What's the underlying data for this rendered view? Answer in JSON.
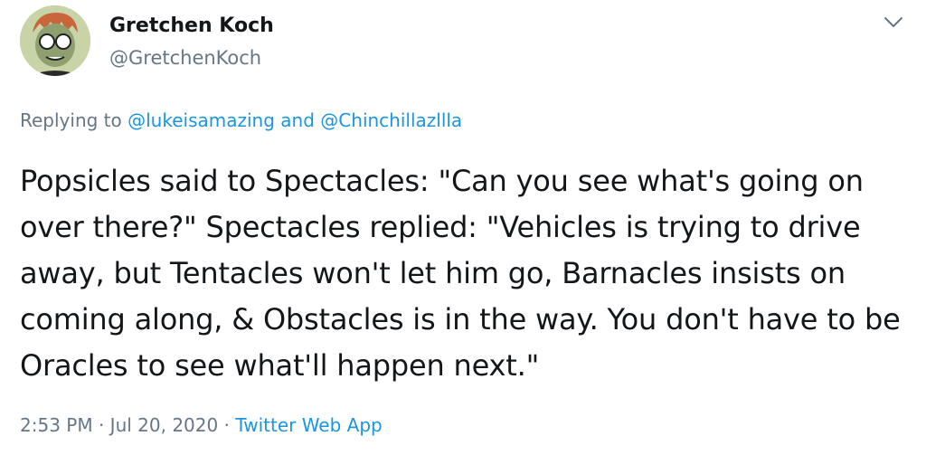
{
  "author": {
    "name": "Gretchen Koch",
    "handle": "@GretchenKoch"
  },
  "reply": {
    "prefix": "Replying to",
    "user1": "@lukeisamazing",
    "and": "and",
    "user2": "@Chinchillazllla"
  },
  "tweet": {
    "text": "Popsicles said to Spectacles: \"Can you see what's going on over there?\" Spectacles replied: \"Vehicles is trying to drive away, but Tentacles won't let him go, Barnacles insists on coming along, & Obstacles is in the way. You don't have to be Oracles to see what'll happen next.\""
  },
  "meta": {
    "time": "2:53 PM",
    "separator": "·",
    "date": "Jul 20, 2020",
    "source": "Twitter Web App"
  },
  "icons": {
    "menu": "chevron-down-icon",
    "avatar": "cartoon-avatar"
  },
  "colors": {
    "link": "#1b95e0",
    "secondary": "#657786",
    "text": "#14171a"
  }
}
